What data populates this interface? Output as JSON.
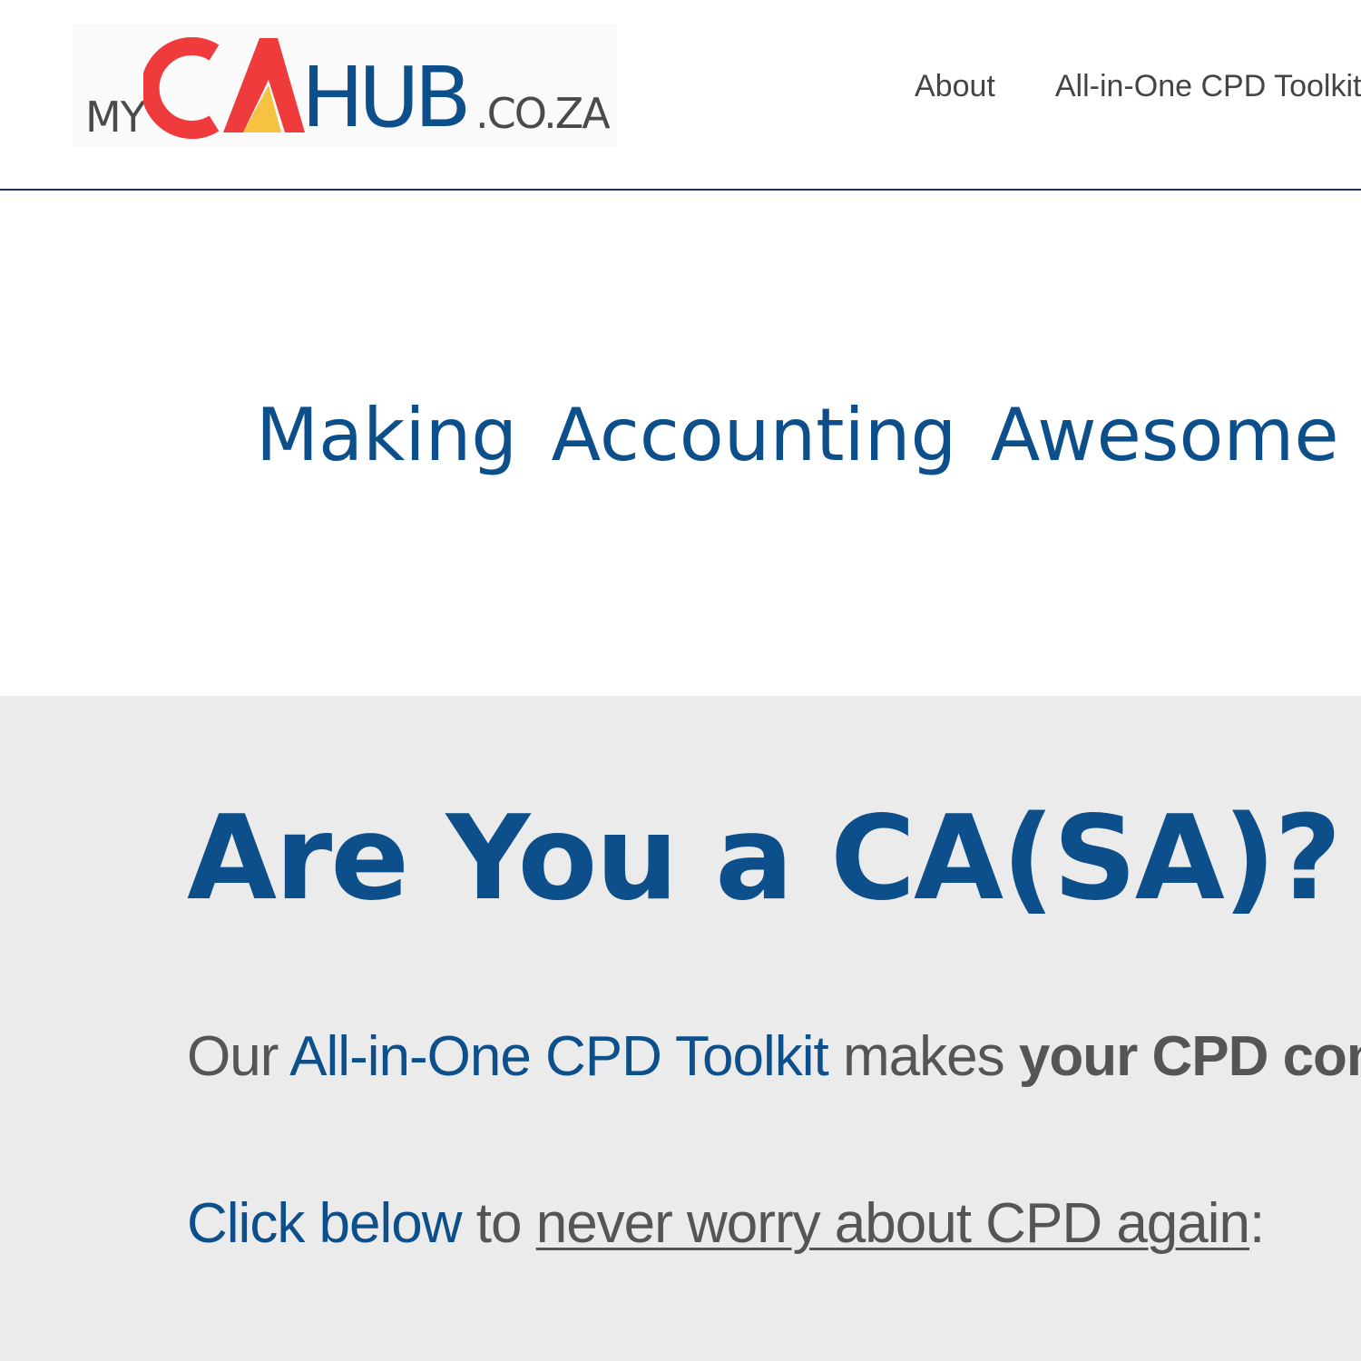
{
  "header": {
    "logo": {
      "prefix": "MY",
      "brand_ca": "CA",
      "brand_hub": "HUB",
      "suffix": ".CO.ZA",
      "colors": {
        "ca_red": "#ef3b3b",
        "ca_yellow": "#f5c242",
        "hub_blue": "#0d4f8b",
        "grey_text": "#4a4a4a"
      }
    },
    "nav": [
      {
        "label": "About"
      },
      {
        "label": "All-in-One CPD Toolkit"
      }
    ]
  },
  "hero": {
    "tagline": "Making Accounting Awesome"
  },
  "section": {
    "heading": "Are You a CA(SA)?",
    "para1": {
      "t1": "Our ",
      "t2": "All-in-One CPD Toolkit",
      "t3": " makes ",
      "t4": "your CPD comp"
    },
    "para2": {
      "t1": "Click below",
      "t2": " to ",
      "t3": "never worry about CPD again",
      "t4": ":"
    }
  },
  "colors": {
    "accent_blue": "#0d4f8b",
    "text_grey": "#555555",
    "section_bg": "#ebebeb",
    "header_border": "#1d2f55"
  }
}
